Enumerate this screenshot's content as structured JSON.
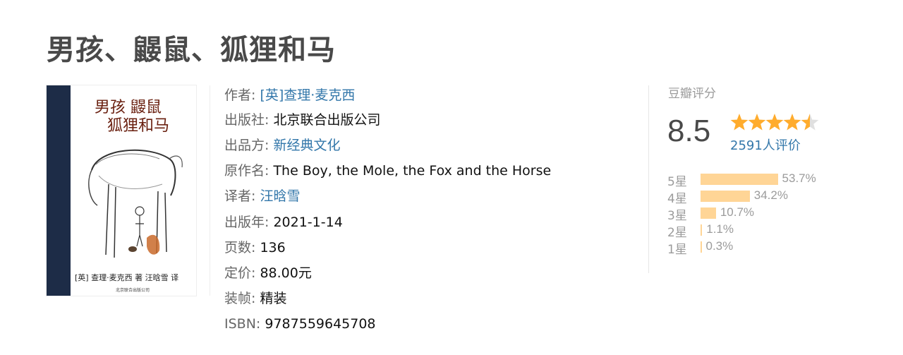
{
  "book": {
    "title": "男孩、鼹鼠、狐狸和马"
  },
  "cover": {
    "spine_color": "#1d2c47",
    "title_line1": "男孩 鼹鼠",
    "title_line2": "狐狸和马",
    "byline": "[英] 查理·麦克西 著   汪晗雪 译",
    "publisher_mark": "北京联合出版公司"
  },
  "info": {
    "author_label": "作者:",
    "author_value": "[英]查理·麦克西",
    "publisher_label": "出版社:",
    "publisher_value": "北京联合出版公司",
    "producer_label": "出品方:",
    "producer_value": "新经典文化",
    "original_title_label": "原作名:",
    "original_title_value": "The Boy, the Mole, the Fox and the Horse",
    "translator_label": "译者:",
    "translator_value": "汪晗雪",
    "year_label": "出版年:",
    "year_value": "2021-1-14",
    "pages_label": "页数:",
    "pages_value": "136",
    "price_label": "定价:",
    "price_value": "88.00元",
    "binding_label": "装帧:",
    "binding_value": "精装",
    "isbn_label": "ISBN:",
    "isbn_value": "9787559645708"
  },
  "rating": {
    "title": "豆瓣评分",
    "score": "8.5",
    "stars": 4.5,
    "star_color": "#ffac2d",
    "votes": "2591人评价",
    "bar_color": "#ffd596",
    "distribution": [
      {
        "label": "5星",
        "percent": 53.7,
        "text": "53.7%"
      },
      {
        "label": "4星",
        "percent": 34.2,
        "text": "34.2%"
      },
      {
        "label": "3星",
        "percent": 10.7,
        "text": "10.7%"
      },
      {
        "label": "2星",
        "percent": 1.1,
        "text": "1.1%"
      },
      {
        "label": "1星",
        "percent": 0.3,
        "text": "0.3%"
      }
    ]
  }
}
